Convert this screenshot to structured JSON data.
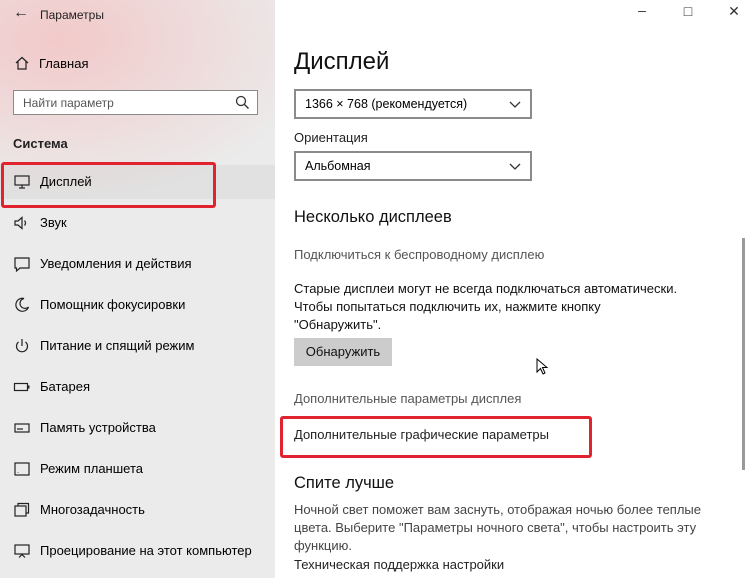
{
  "window": {
    "title": "Параметры"
  },
  "sidebar": {
    "home_label": "Главная",
    "search_placeholder": "Найти параметр",
    "section_title": "Система",
    "items": [
      {
        "label": "Дисплей",
        "icon": "monitor-icon"
      },
      {
        "label": "Звук",
        "icon": "speaker-icon"
      },
      {
        "label": "Уведомления и действия",
        "icon": "notification-icon"
      },
      {
        "label": "Помощник фокусировки",
        "icon": "moon-icon"
      },
      {
        "label": "Питание и спящий режим",
        "icon": "power-icon"
      },
      {
        "label": "Батарея",
        "icon": "battery-icon"
      },
      {
        "label": "Память устройства",
        "icon": "storage-icon"
      },
      {
        "label": "Режим планшета",
        "icon": "tablet-icon"
      },
      {
        "label": "Многозадачность",
        "icon": "multitask-icon"
      },
      {
        "label": "Проецирование на этот компьютер",
        "icon": "projector-icon"
      }
    ],
    "active_item": "Дисплей"
  },
  "content": {
    "title": "Дисплей",
    "resolution_value": "1366 × 768 (рекомендуется)",
    "orientation_label": "Ориентация",
    "orientation_value": "Альбомная",
    "multi_display_heading": "Несколько дисплеев",
    "wireless_link": "Подключиться к беспроводному дисплею",
    "old_displays_text_line1": "Старые дисплеи могут не всегда подключаться автоматически.",
    "old_displays_text_line2": "Чтобы попытаться подключить их, нажмите кнопку",
    "old_displays_text_line3": "\"Обнаружить\".",
    "detect_button": "Обнаружить",
    "advanced_display_link": "Дополнительные параметры дисплея",
    "graphics_settings_link": "Дополнительные графические параметры",
    "sleep_heading": "Спите лучше",
    "night_light_text_line1": "Ночной свет поможет вам заснуть, отображая ночью более теплые",
    "night_light_text_line2": "цвета. Выберите \"Параметры ночного света\", чтобы настроить эту",
    "night_light_text_line3": "функцию.",
    "support_link": "Техническая поддержка настройки"
  },
  "colors": {
    "highlight": "#e1222f",
    "sidebar_bg": "#ebebeb",
    "button_bg": "#cccccc"
  }
}
